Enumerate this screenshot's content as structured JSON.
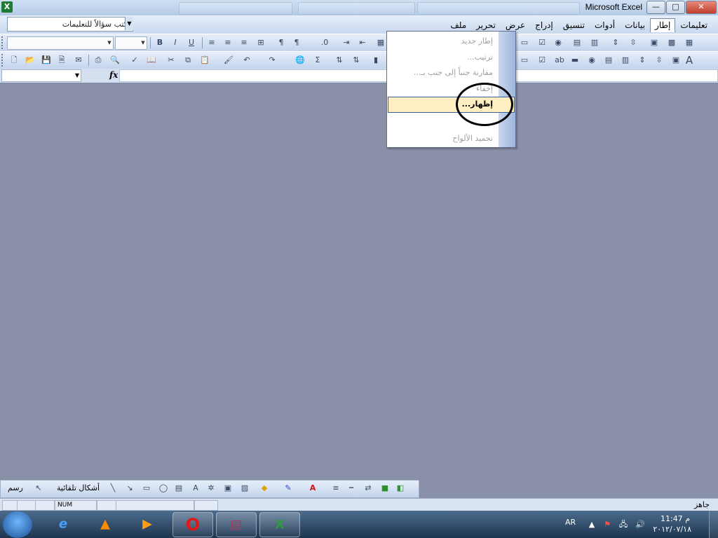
{
  "window": {
    "title": "Microsoft Excel",
    "minimize": "—",
    "maximize": "□",
    "close": "✕",
    "app_icon": "excel-icon"
  },
  "menubar": {
    "items": [
      {
        "label": "ملف"
      },
      {
        "label": "تحرير"
      },
      {
        "label": "عرض"
      },
      {
        "label": "إدراج"
      },
      {
        "label": "تنسيق"
      },
      {
        "label": "أدوات"
      },
      {
        "label": "بيانات"
      },
      {
        "label": "إطار"
      },
      {
        "label": "تعليمات"
      }
    ],
    "ask_placeholder": "اكتب سؤالاً للتعليمات"
  },
  "window_menu": {
    "items": [
      {
        "label": "إطار جديد"
      },
      {
        "label": "ترتيب..."
      },
      {
        "label": "مقارنة جنباً إلى جنب بـ..."
      },
      {
        "label": "إخفاء"
      },
      {
        "label": "إظهار..."
      },
      {
        "label": "تجميد الألواح"
      }
    ]
  },
  "formula_bar": {
    "fx": "fx"
  },
  "drawing_toolbar": {
    "draw_label": "رسم",
    "autoshapes_label": "أشكال تلقائية"
  },
  "statusbar": {
    "ready": "جاهز",
    "num": "NUM"
  },
  "taskbar": {
    "language": "AR",
    "time": "11:47 م",
    "date": "٢٠١٢/٠٧/١٨"
  },
  "colors": {
    "workspace": "#8a90a8",
    "menu_highlight": "#ffeec2"
  }
}
